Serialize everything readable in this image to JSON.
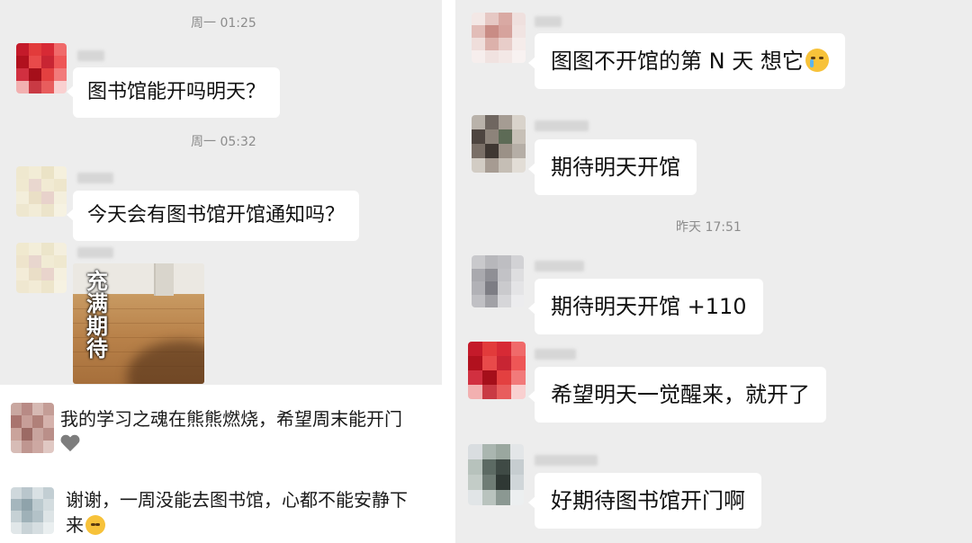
{
  "left_top": {
    "messages": [
      {
        "time": "周一 01:25",
        "text": "图书馆能开吗明天？"
      },
      {
        "time": "周一 05:32",
        "text": "今天会有图书馆开馆通知吗？"
      },
      {
        "image_caption": "充满期待"
      }
    ]
  },
  "left_bottom": {
    "comments": [
      {
        "text": "我的学习之魂在熊熊燃烧，希望周末能开门",
        "emoji": "broken-heart-icon"
      },
      {
        "text_line1": "谢谢，一周没能去图书馆，心都不能安静下",
        "text_line2": "来",
        "emoji": "laughing-crying-face-icon"
      }
    ]
  },
  "right": {
    "messages": [
      {
        "text": "图图不开馆的第 N 天  想它",
        "emoji": "crying-face-icon"
      },
      {
        "text": "期待明天开馆"
      },
      {
        "time": "昨天 17:51"
      },
      {
        "text": "期待明天开馆 +110"
      },
      {
        "text": "希望明天一觉醒来，就开了"
      },
      {
        "text": "好期待图书馆开门啊"
      }
    ]
  }
}
